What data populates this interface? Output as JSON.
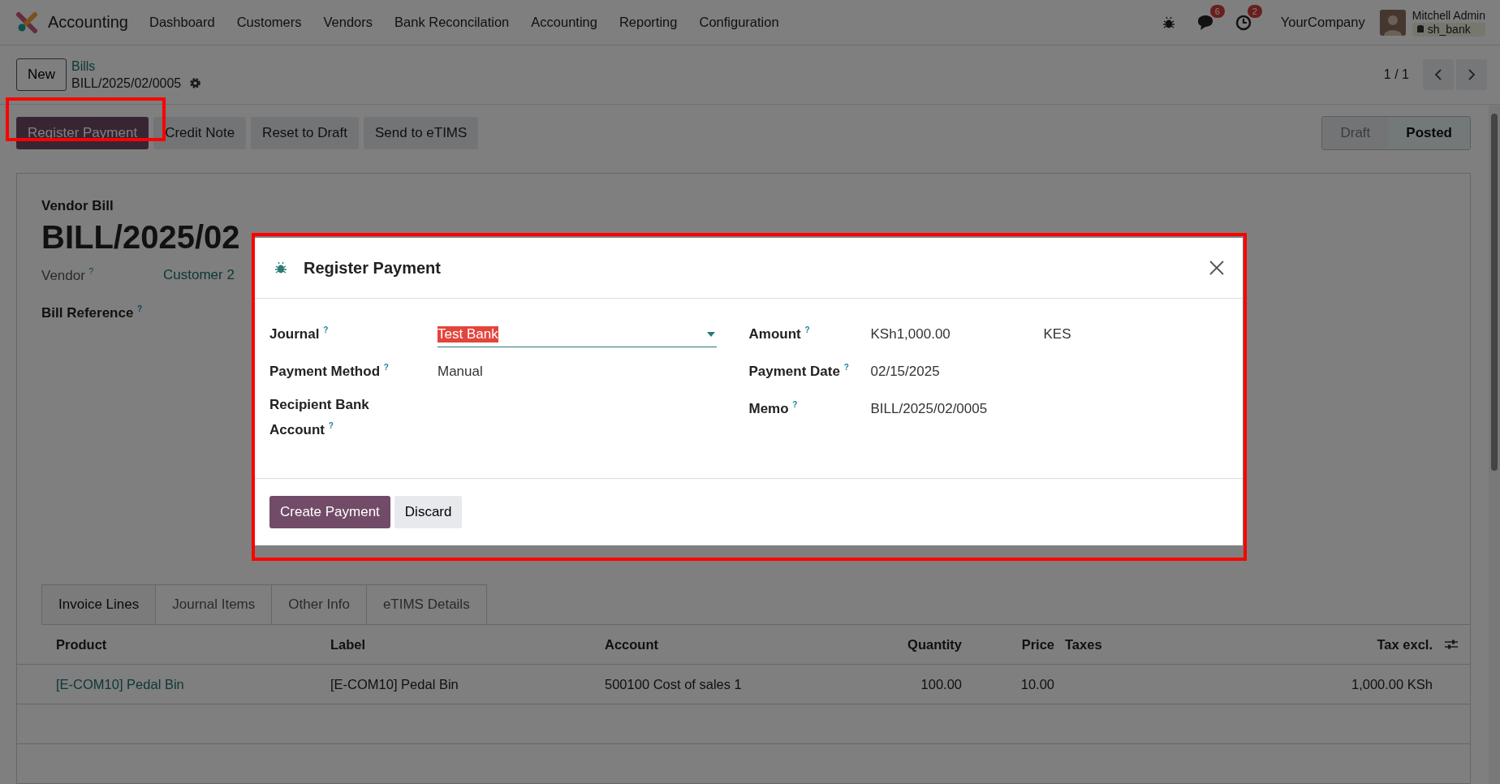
{
  "navbar": {
    "app_name": "Accounting",
    "menu": [
      "Dashboard",
      "Customers",
      "Vendors",
      "Bank Reconcilation",
      "Accounting",
      "Reporting",
      "Configuration"
    ],
    "message_count": "6",
    "activity_count": "2",
    "company": "YourCompany",
    "user": "Mitchell Admin",
    "database": "sh_bank"
  },
  "breadcrumb": {
    "new_button": "New",
    "parent": "Bills",
    "current": "BILL/2025/02/0005"
  },
  "pager": "1 / 1",
  "actions": [
    {
      "label": "Register Payment",
      "kind": "primary",
      "highlighted": true
    },
    {
      "label": "Credit Note",
      "kind": "secondary",
      "highlighted": false
    },
    {
      "label": "Reset to Draft",
      "kind": "secondary",
      "highlighted": false
    },
    {
      "label": "Send to eTIMS",
      "kind": "secondary",
      "highlighted": false
    }
  ],
  "status": [
    {
      "label": "Draft",
      "selected": false
    },
    {
      "label": "Posted",
      "selected": true
    }
  ],
  "bill": {
    "type": "Vendor Bill",
    "number": "BILL/2025/02",
    "vendor_label": "Vendor $^{?}$",
    "vendor": "Customer 2",
    "reference_label": "Bill Reference $^{?}$"
  },
  "tabs": [
    {
      "label": "Invoice Lines",
      "selected": true
    },
    {
      "label": "Journal Items",
      "selected": false
    },
    {
      "label": "Other Info",
      "selected": false
    },
    {
      "label": "eTIMS Details",
      "selected": false
    }
  ],
  "table": {
    "columns": [
      "Product",
      "Label",
      "Account",
      "Quantity",
      "Price",
      "Taxes",
      "Tax excl."
    ],
    "rows": [
      {
        "product": "[E-COM10] Pedal Bin",
        "label": "[E-COM10] Pedal Bin",
        "account": "500100 Cost of sales 1",
        "quantity": "100.00",
        "price": "10.00",
        "tax_excl": "1,000.00 KSh"
      }
    ]
  },
  "dialog": {
    "title": "Register Payment",
    "highlighted": true,
    "left_fields": [
      {
        "label": "Journal $^{?}$",
        "kind": "dropdown",
        "value": "Test Bank",
        "text_selected": true
      },
      {
        "label": "Payment Method $^{?}$",
        "kind": "text",
        "value": "Manual"
      },
      {
        "label": "Recipient Bank Account $^{?}$",
        "kind": "text"
      }
    ],
    "right_fields": [
      {
        "label": "Amount $^{?}$",
        "kind": "text",
        "value": "KSh1,000.00",
        "currency": "KES"
      },
      {
        "label": "Payment Date $^{?}$",
        "kind": "text",
        "value": "02/15/2025"
      },
      {
        "label": "Memo $^{?}$",
        "kind": "text",
        "value": "BILL/2025/02/0005"
      }
    ],
    "buttons": [
      {
        "label": "Create Payment",
        "kind": "primary"
      },
      {
        "label": "Discard",
        "kind": "secondary"
      }
    ]
  }
}
